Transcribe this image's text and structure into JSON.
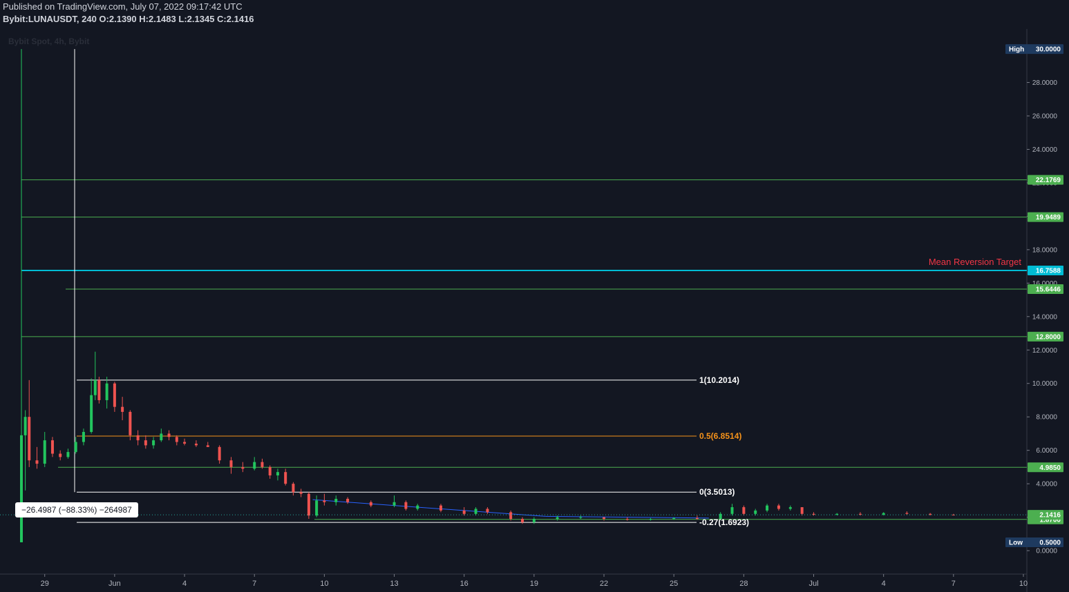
{
  "header": {
    "published": "Published on TradingView.com, July 07, 2022 09:17:42 UTC",
    "symbol": "Bybit:LUNAUSDT, 240",
    "open_label": "O:",
    "open": "2.1390",
    "high_label": "H:",
    "high": "2.1483",
    "low_label": "L:",
    "low": "2.1345",
    "close_label": "C:",
    "close": "2.1416"
  },
  "pane_label": "Bybit Spot, 4h, Bybit",
  "measure_label": "−26.4987 (−88.33%) −264987",
  "annotation": {
    "mean_reversion": "Mean Reversion Target"
  },
  "colors": {
    "background": "#131722",
    "grid": "#1e222d",
    "up": "#26a69a",
    "up_bright": "#22c55e",
    "down": "#ef5350",
    "level_green": "#4caf50",
    "mean_reversion": "#00bcd4",
    "fib_orange": "#f7931a",
    "fib_white": "#ffffff",
    "trendline": "#2962ff",
    "badge_dark": "#1e3a5f",
    "text_red": "#f23645"
  },
  "chart_data": {
    "type": "candlestick",
    "title": "Bybit:LUNAUSDT, 240",
    "y_axis": {
      "ticks": [
        "0.0000",
        "2.0000",
        "4.0000",
        "6.0000",
        "8.0000",
        "10.0000",
        "12.0000",
        "14.0000",
        "16.0000",
        "18.0000",
        "20.0000",
        "22.0000",
        "24.0000",
        "26.0000",
        "28.0000",
        "30.0000"
      ],
      "ylim": [
        -1.4,
        31.2
      ]
    },
    "x_axis": {
      "ticks": [
        "29",
        "Jun",
        "4",
        "7",
        "10",
        "13",
        "16",
        "19",
        "22",
        "25",
        "28",
        "Jul",
        "4",
        "7",
        "10"
      ],
      "start": "2022-05-28",
      "end": "2022-07-10"
    },
    "horizontal_levels": [
      {
        "price": 22.1769,
        "label": "22.1769",
        "color": "green"
      },
      {
        "price": 19.9489,
        "label": "19.9489",
        "color": "green"
      },
      {
        "price": 16.7588,
        "label": "16.7588",
        "color": "cyan",
        "annotation": "Mean Reversion Target"
      },
      {
        "price": 15.6446,
        "label": "15.6446",
        "color": "green"
      },
      {
        "price": 12.8,
        "label": "12.8000",
        "color": "green"
      },
      {
        "price": 4.985,
        "label": "4.9850",
        "color": "green"
      },
      {
        "price": 1.87,
        "label": "1.8700",
        "color": "green"
      }
    ],
    "fib_levels": [
      {
        "ratio": "1",
        "price": 10.2014,
        "label": "1(10.2014)",
        "color": "white"
      },
      {
        "ratio": "0.5",
        "price": 6.8514,
        "label": "0.5(6.8514)",
        "color": "orange"
      },
      {
        "ratio": "0",
        "price": 3.5013,
        "label": "0(3.5013)",
        "color": "white"
      },
      {
        "ratio": "-0.27",
        "price": 1.6923,
        "label": "-0.27(1.6923)",
        "color": "white"
      }
    ],
    "price_badges": {
      "high": {
        "label": "High",
        "value": "30.0000"
      },
      "low": {
        "label": "Low",
        "value": "0.5000"
      },
      "last": {
        "value": "2.1416"
      }
    },
    "candles": [
      [
        "2022-05-28",
        0.5,
        30.0,
        0.5,
        6.9
      ],
      [
        "2022-05-28 04:00",
        6.9,
        8.4,
        3.6,
        8.0
      ],
      [
        "2022-05-28 08:00",
        8.0,
        10.2,
        5.0,
        5.4
      ],
      [
        "2022-05-28 16:00",
        5.4,
        6.2,
        4.9,
        5.2
      ],
      [
        "2022-05-29",
        5.2,
        7.1,
        5.0,
        6.6
      ],
      [
        "2022-05-29 08:00",
        6.6,
        6.8,
        5.6,
        5.8
      ],
      [
        "2022-05-29 16:00",
        5.8,
        6.0,
        5.4,
        5.6
      ],
      [
        "2022-05-30",
        5.6,
        6.1,
        5.5,
        5.9
      ],
      [
        "2022-05-30 08:00",
        5.9,
        6.8,
        5.8,
        6.5
      ],
      [
        "2022-05-30 16:00",
        6.5,
        7.3,
        6.3,
        7.1
      ],
      [
        "2022-05-31",
        7.1,
        10.3,
        7.0,
        9.3
      ],
      [
        "2022-05-31 04:00",
        9.3,
        11.9,
        9.0,
        10.2
      ],
      [
        "2022-05-31 08:00",
        10.2,
        10.4,
        8.8,
        9.0
      ],
      [
        "2022-05-31 16:00",
        9.0,
        10.4,
        8.5,
        10.0
      ],
      [
        "2022-06-01",
        10.0,
        10.1,
        8.3,
        8.6
      ],
      [
        "2022-06-01 08:00",
        8.6,
        9.2,
        7.8,
        8.3
      ],
      [
        "2022-06-01 16:00",
        8.3,
        8.4,
        6.6,
        6.9
      ],
      [
        "2022-06-02",
        6.9,
        7.2,
        6.3,
        6.6
      ],
      [
        "2022-06-02 08:00",
        6.6,
        6.9,
        6.1,
        6.3
      ],
      [
        "2022-06-02 16:00",
        6.3,
        6.8,
        6.1,
        6.6
      ],
      [
        "2022-06-03",
        6.6,
        7.3,
        6.5,
        7.0
      ],
      [
        "2022-06-03 08:00",
        7.0,
        7.2,
        6.6,
        6.8
      ],
      [
        "2022-06-03 16:00",
        6.8,
        6.9,
        6.3,
        6.5
      ],
      [
        "2022-06-04",
        6.5,
        6.7,
        6.3,
        6.4
      ],
      [
        "2022-06-04 12:00",
        6.4,
        6.6,
        6.2,
        6.3
      ],
      [
        "2022-06-05",
        6.3,
        6.5,
        6.2,
        6.2
      ],
      [
        "2022-06-05 12:00",
        6.2,
        6.3,
        5.2,
        5.4
      ],
      [
        "2022-06-06",
        5.4,
        5.6,
        4.6,
        5.0
      ],
      [
        "2022-06-06 12:00",
        5.0,
        5.3,
        4.7,
        4.9
      ],
      [
        "2022-06-07",
        4.9,
        5.6,
        4.8,
        5.3
      ],
      [
        "2022-06-07 08:00",
        5.3,
        5.5,
        4.9,
        5.0
      ],
      [
        "2022-06-07 16:00",
        5.0,
        5.1,
        4.3,
        4.5
      ],
      [
        "2022-06-08",
        4.5,
        4.9,
        4.2,
        4.7
      ],
      [
        "2022-06-08 08:00",
        4.7,
        4.9,
        3.9,
        4.0
      ],
      [
        "2022-06-08 16:00",
        4.0,
        4.1,
        3.3,
        3.5
      ],
      [
        "2022-06-09",
        3.5,
        3.7,
        3.2,
        3.4
      ],
      [
        "2022-06-09 08:00",
        3.4,
        3.5,
        1.9,
        2.1
      ],
      [
        "2022-06-09 16:00",
        2.1,
        3.3,
        2.0,
        3.0
      ],
      [
        "2022-06-10",
        3.0,
        3.4,
        2.7,
        2.9
      ],
      [
        "2022-06-10 12:00",
        2.9,
        3.3,
        2.7,
        3.1
      ],
      [
        "2022-06-11",
        3.1,
        3.2,
        2.8,
        2.9
      ],
      [
        "2022-06-12",
        2.9,
        3.0,
        2.6,
        2.7
      ],
      [
        "2022-06-13",
        2.7,
        3.3,
        2.6,
        2.9
      ],
      [
        "2022-06-13 12:00",
        2.9,
        3.0,
        2.4,
        2.5
      ],
      [
        "2022-06-14",
        2.5,
        2.8,
        2.4,
        2.7
      ],
      [
        "2022-06-15",
        2.7,
        2.8,
        2.3,
        2.4
      ],
      [
        "2022-06-16",
        2.4,
        2.6,
        2.1,
        2.2
      ],
      [
        "2022-06-16 12:00",
        2.2,
        2.6,
        2.1,
        2.5
      ],
      [
        "2022-06-17",
        2.5,
        2.6,
        2.2,
        2.3
      ],
      [
        "2022-06-18",
        2.3,
        2.4,
        1.8,
        1.9
      ],
      [
        "2022-06-18 12:00",
        1.9,
        2.0,
        1.6,
        1.7
      ],
      [
        "2022-06-19",
        1.7,
        2.0,
        1.6,
        1.9
      ],
      [
        "2022-06-20",
        1.9,
        2.1,
        1.8,
        2.0
      ],
      [
        "2022-06-21",
        2.0,
        2.1,
        1.9,
        2.0
      ],
      [
        "2022-06-22",
        2.0,
        2.0,
        1.8,
        1.9
      ],
      [
        "2022-06-23",
        1.9,
        2.0,
        1.8,
        1.85
      ],
      [
        "2022-06-24",
        1.85,
        1.95,
        1.8,
        1.9
      ],
      [
        "2022-06-25",
        1.9,
        2.0,
        1.85,
        1.95
      ],
      [
        "2022-06-26",
        1.95,
        2.1,
        1.85,
        1.9
      ],
      [
        "2022-06-27",
        1.9,
        2.3,
        1.9,
        2.2
      ],
      [
        "2022-06-27 12:00",
        2.2,
        2.8,
        2.1,
        2.6
      ],
      [
        "2022-06-28",
        2.6,
        2.7,
        2.1,
        2.2
      ],
      [
        "2022-06-28 12:00",
        2.2,
        2.5,
        2.1,
        2.4
      ],
      [
        "2022-06-29",
        2.4,
        2.8,
        2.3,
        2.7
      ],
      [
        "2022-06-29 12:00",
        2.7,
        2.8,
        2.4,
        2.5
      ],
      [
        "2022-06-30",
        2.5,
        2.7,
        2.4,
        2.6
      ],
      [
        "2022-06-30 12:00",
        2.6,
        2.6,
        2.1,
        2.2
      ],
      [
        "2022-07-01",
        2.2,
        2.3,
        2.1,
        2.15
      ],
      [
        "2022-07-02",
        2.15,
        2.25,
        2.1,
        2.2
      ],
      [
        "2022-07-03",
        2.2,
        2.3,
        2.1,
        2.15
      ],
      [
        "2022-07-04",
        2.15,
        2.3,
        2.1,
        2.25
      ],
      [
        "2022-07-05",
        2.25,
        2.35,
        2.15,
        2.2
      ],
      [
        "2022-07-06",
        2.2,
        2.25,
        2.1,
        2.15
      ],
      [
        "2022-07-07",
        2.15,
        2.2,
        2.1,
        2.14
      ]
    ]
  }
}
